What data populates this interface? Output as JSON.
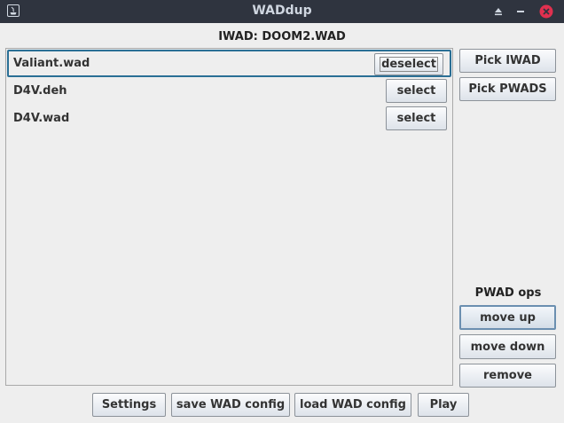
{
  "window": {
    "title": "WADdup"
  },
  "iwad": {
    "label": "IWAD: DOOM2.WAD"
  },
  "wad_list": [
    {
      "name": "Valiant.wad",
      "action": "deselect",
      "selected": true
    },
    {
      "name": "D4V.deh",
      "action": "select",
      "selected": false
    },
    {
      "name": "D4V.wad",
      "action": "select",
      "selected": false
    }
  ],
  "side": {
    "pick_iwad": "Pick IWAD",
    "pick_pwads": "Pick PWADS",
    "ops_label": "PWAD ops",
    "move_up": "move up",
    "move_down": "move down",
    "remove": "remove"
  },
  "bottom": {
    "settings": "Settings",
    "save": "save WAD config",
    "load": "load WAD config",
    "play": "Play"
  },
  "colors": {
    "titlebar": "#2f343f",
    "close": "#e0304f",
    "selection_border": "#2a6f95"
  },
  "icons": {
    "app": "java-icon",
    "shade": "shade-triangle-icon",
    "minimize": "minimize-dash-icon",
    "close": "close-circle-icon"
  }
}
